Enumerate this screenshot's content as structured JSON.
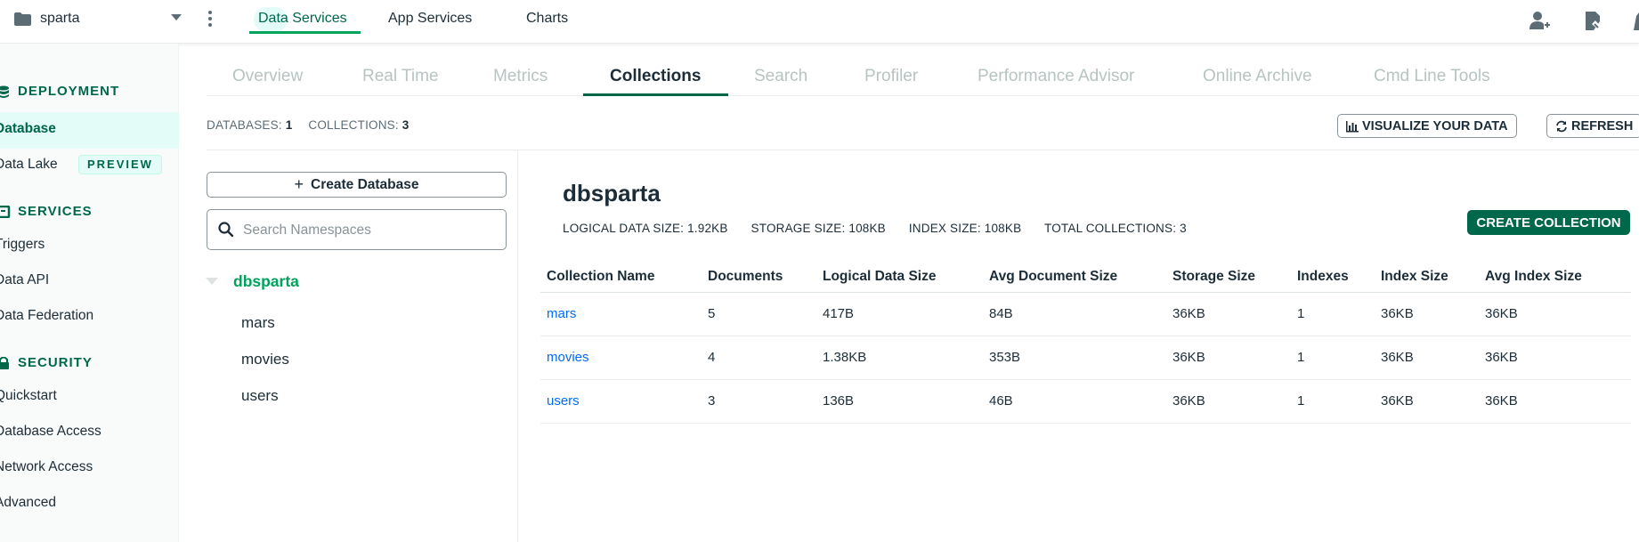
{
  "topbar": {
    "project_name": "sparta",
    "tabs": [
      {
        "label": "Data Services",
        "active": true
      },
      {
        "label": "App Services",
        "active": false
      },
      {
        "label": "Charts",
        "active": false
      }
    ],
    "icons": [
      "folder-icon",
      "caret-down-icon",
      "kebab-menu-icon",
      "invite-user-icon",
      "activity-feed-icon"
    ]
  },
  "sidebar": {
    "deployment": {
      "title": "DEPLOYMENT",
      "items": [
        {
          "label": "Database",
          "active": true
        },
        {
          "label": "Data Lake",
          "badge": "PREVIEW"
        }
      ]
    },
    "services": {
      "title": "SERVICES",
      "items": [
        {
          "label": "Triggers"
        },
        {
          "label": "Data API"
        },
        {
          "label": "Data Federation"
        }
      ]
    },
    "security": {
      "title": "SECURITY",
      "items": [
        {
          "label": "Quickstart"
        },
        {
          "label": "Database Access"
        },
        {
          "label": "Network Access"
        },
        {
          "label": "Advanced"
        }
      ]
    }
  },
  "subtabs": [
    {
      "label": "Overview"
    },
    {
      "label": "Real Time"
    },
    {
      "label": "Metrics"
    },
    {
      "label": "Collections",
      "active": true
    },
    {
      "label": "Search"
    },
    {
      "label": "Profiler"
    },
    {
      "label": "Performance Advisor"
    },
    {
      "label": "Online Archive"
    },
    {
      "label": "Cmd Line Tools"
    }
  ],
  "summary": {
    "databases_label": "DATABASES:",
    "databases_value": "1",
    "collections_label": "COLLECTIONS:",
    "collections_value": "3",
    "visualize_label": "VISUALIZE YOUR DATA",
    "refresh_label": "REFRESH"
  },
  "left_panel": {
    "create_database_label": "Create Database",
    "search_placeholder": "Search Namespaces",
    "database": "dbsparta",
    "collections": [
      "mars",
      "movies",
      "users"
    ]
  },
  "detail": {
    "title": "dbsparta",
    "stats": {
      "logical_data_size": "LOGICAL DATA SIZE: 1.92KB",
      "storage_size": "STORAGE SIZE: 108KB",
      "index_size": "INDEX SIZE: 108KB",
      "total_collections": "TOTAL COLLECTIONS: 3"
    },
    "create_collection_label": "CREATE COLLECTION",
    "table": {
      "columns": [
        "Collection Name",
        "Documents",
        "Logical Data Size",
        "Avg Document Size",
        "Storage Size",
        "Indexes",
        "Index Size",
        "Avg Index Size"
      ],
      "rows": [
        [
          "mars",
          "5",
          "417B",
          "84B",
          "36KB",
          "1",
          "36KB",
          "36KB"
        ],
        [
          "movies",
          "4",
          "1.38KB",
          "353B",
          "36KB",
          "1",
          "36KB",
          "36KB"
        ],
        [
          "users",
          "3",
          "136B",
          "46B",
          "36KB",
          "1",
          "36KB",
          "36KB"
        ]
      ]
    }
  }
}
